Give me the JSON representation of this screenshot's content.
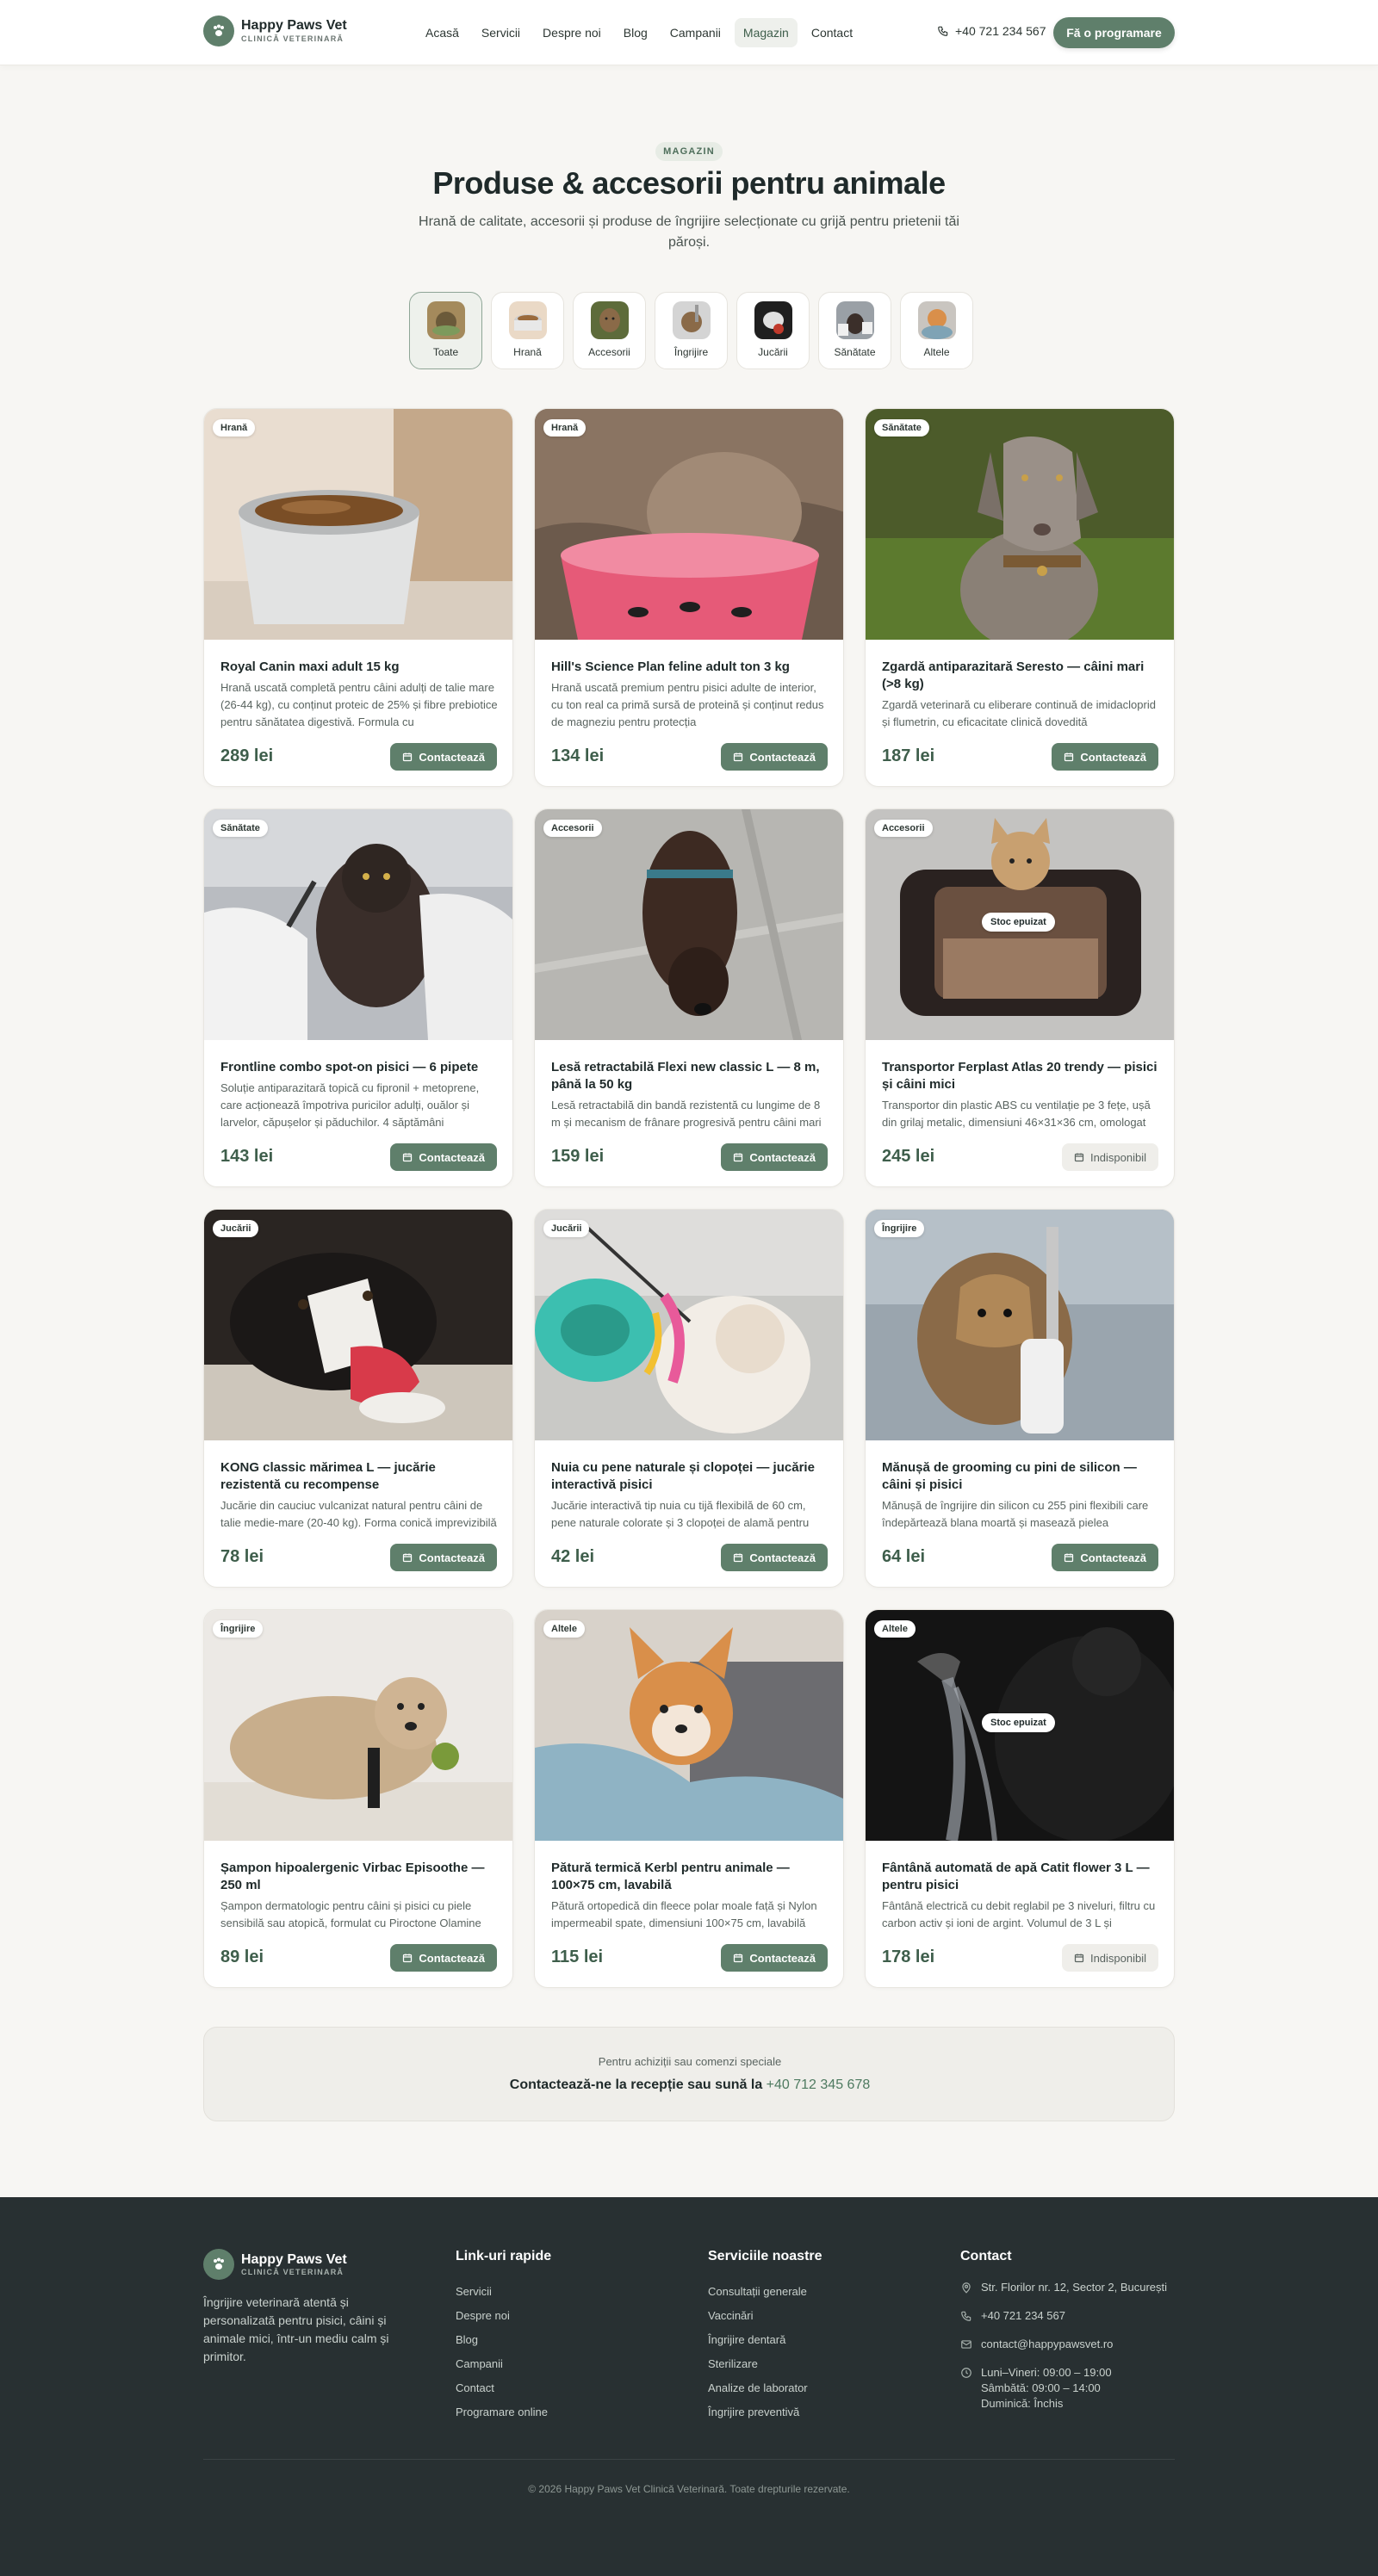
{
  "brand": {
    "name": "Happy Paws Vet",
    "tagline": "CLINICĂ VETERINARĂ"
  },
  "nav": [
    {
      "label": "Acasă"
    },
    {
      "label": "Servicii"
    },
    {
      "label": "Despre noi"
    },
    {
      "label": "Blog"
    },
    {
      "label": "Campanii"
    },
    {
      "label": "Magazin",
      "active": true
    },
    {
      "label": "Contact"
    }
  ],
  "header": {
    "phone": "+40 721 234 567",
    "cta": "Fă o programare"
  },
  "hero": {
    "eyebrow": "MAGAZIN",
    "title": "Produse & accesorii pentru animale",
    "subtitle": "Hrană de calitate, accesorii și produse de îngrijire selecționate cu grijă pentru prietenii tăi păroși."
  },
  "categories": [
    {
      "label": "Toate",
      "active": true
    },
    {
      "label": "Hrană"
    },
    {
      "label": "Accesorii"
    },
    {
      "label": "Îngrijire"
    },
    {
      "label": "Jucării"
    },
    {
      "label": "Sănătate"
    },
    {
      "label": "Altele"
    }
  ],
  "products": [
    {
      "tag": "Hrană",
      "title": "Royal Canin maxi adult 15 kg",
      "desc": "Hrană uscată completă pentru câini adulți de talie mare (26-44 kg), cu conținut proteic de 25% și fibre prebiotice pentru sănătatea digestivă. Formula cu",
      "price": "289 lei",
      "action": "Contactează",
      "available": true
    },
    {
      "tag": "Hrană",
      "title": "Hill's Science Plan feline adult ton 3 kg",
      "desc": "Hrană uscată premium pentru pisici adulte de interior, cu ton real ca primă sursă de proteină și conținut redus de magneziu pentru protecția",
      "price": "134 lei",
      "action": "Contactează",
      "available": true
    },
    {
      "tag": "Sănătate",
      "title": "Zgardă antiparazitară Seresto — câini mari (>8 kg)",
      "desc": "Zgardă veterinară cu eliberare continuă de imidacloprid și flumetrin, cu eficacitate clinică dovedită",
      "price": "187 lei",
      "action": "Contactează",
      "available": true
    },
    {
      "tag": "Sănătate",
      "title": "Frontline combo spot-on pisici — 6 pipete",
      "desc": "Soluție antiparazitară topică cu fipronil + metoprene, care acționează împotriva puricilor adulți, ouălor și larvelor, căpușelor și păduchilor. 4 săptămâni",
      "price": "143 lei",
      "action": "Contactează",
      "available": true
    },
    {
      "tag": "Accesorii",
      "title": "Lesă retractabilă Flexi new classic L — 8 m, până la 50 kg",
      "desc": "Lesă retractabilă din bandă rezistentă cu lungime de 8 m și mecanism de frânare progresivă pentru câini mari",
      "price": "159 lei",
      "action": "Contactează",
      "available": true
    },
    {
      "tag": "Accesorii",
      "title": "Transportor Ferplast Atlas 20 trendy — pisici și câini mici",
      "desc": "Transportor din plastic ABS cu ventilație pe 3 fețe, ușă din grilaj metalic, dimensiuni 46×31×36 cm, omologat",
      "price": "245 lei",
      "action": "Indisponibil",
      "available": false,
      "overlay": "Stoc epuizat"
    },
    {
      "tag": "Jucării",
      "title": "KONG classic mărimea L — jucărie rezistentă cu recompense",
      "desc": "Jucărie din cauciuc vulcanizat natural pentru câini de talie medie-mare (20-40 kg). Forma conică imprevizibilă",
      "price": "78 lei",
      "action": "Contactează",
      "available": true
    },
    {
      "tag": "Jucării",
      "title": "Nuia cu pene naturale și clopoței — jucărie interactivă pisici",
      "desc": "Jucărie interactivă tip nuia cu tijă flexibilă de 60 cm, pene naturale colorate și 3 clopoței de alamă pentru",
      "price": "42 lei",
      "action": "Contactează",
      "available": true
    },
    {
      "tag": "Îngrijire",
      "title": "Mănușă de grooming cu pini de silicon — câini și pisici",
      "desc": "Mănușă de îngrijire din silicon cu 255 pini flexibili care îndepărtează blana moartă și masează pielea",
      "price": "64 lei",
      "action": "Contactează",
      "available": true
    },
    {
      "tag": "Îngrijire",
      "title": "Șampon hipoalergenic Virbac Episoothe — 250 ml",
      "desc": "Șampon dermatologic pentru câini și pisici cu piele sensibilă sau atopică, formulat cu Piroctone Olamine",
      "price": "89 lei",
      "action": "Contactează",
      "available": true
    },
    {
      "tag": "Altele",
      "title": "Pătură termică Kerbl pentru animale — 100×75 cm, lavabilă",
      "desc": "Pătură ortopedică din fleece polar moale față și Nylon impermeabil spate, dimensiuni 100×75 cm, lavabilă",
      "price": "115 lei",
      "action": "Contactează",
      "available": true
    },
    {
      "tag": "Altele",
      "title": "Fântână automată de apă Catit flower 3 L — pentru pisici",
      "desc": "Fântână electrică cu debit reglabil pe 3 niveluri, filtru cu carbon activ și ioni de argint. Volumul de 3 L și",
      "price": "178 lei",
      "action": "Indisponibil",
      "available": false,
      "overlay": "Stoc epuizat"
    }
  ],
  "contact_strip": {
    "line1": "Pentru achiziții sau comenzi speciale",
    "line2": "Contactează-ne la recepție sau sună la",
    "phone": "+40 712 345 678"
  },
  "footer": {
    "about": "Îngrijire veterinară atentă și personalizată pentru pisici, câini și animale mici, într-un mediu calm și primitor.",
    "links_title": "Link-uri rapide",
    "links": [
      "Servicii",
      "Despre noi",
      "Blog",
      "Campanii",
      "Contact",
      "Programare online"
    ],
    "services_title": "Serviciile noastre",
    "services": [
      "Consultații generale",
      "Vaccinări",
      "Îngrijire dentară",
      "Sterilizare",
      "Analize de laborator",
      "Îngrijire preventivă"
    ],
    "contact_title": "Contact",
    "address": "Str. Florilor nr. 12, Sector 2, București",
    "phone": "+40 721 234 567",
    "email": "contact@happypawsvet.ro",
    "hours": [
      "Luni–Vineri: 09:00 – 19:00",
      "Sâmbătă: 09:00 – 14:00",
      "Duminică: Închis"
    ],
    "copyright": "© 2026 Happy Paws Vet Clinică Veterinară. Toate drepturile rezervate."
  },
  "colors": {
    "accent": "#5f7f6b",
    "footer_bg": "#283032",
    "page_bg": "#f7f6f3"
  }
}
